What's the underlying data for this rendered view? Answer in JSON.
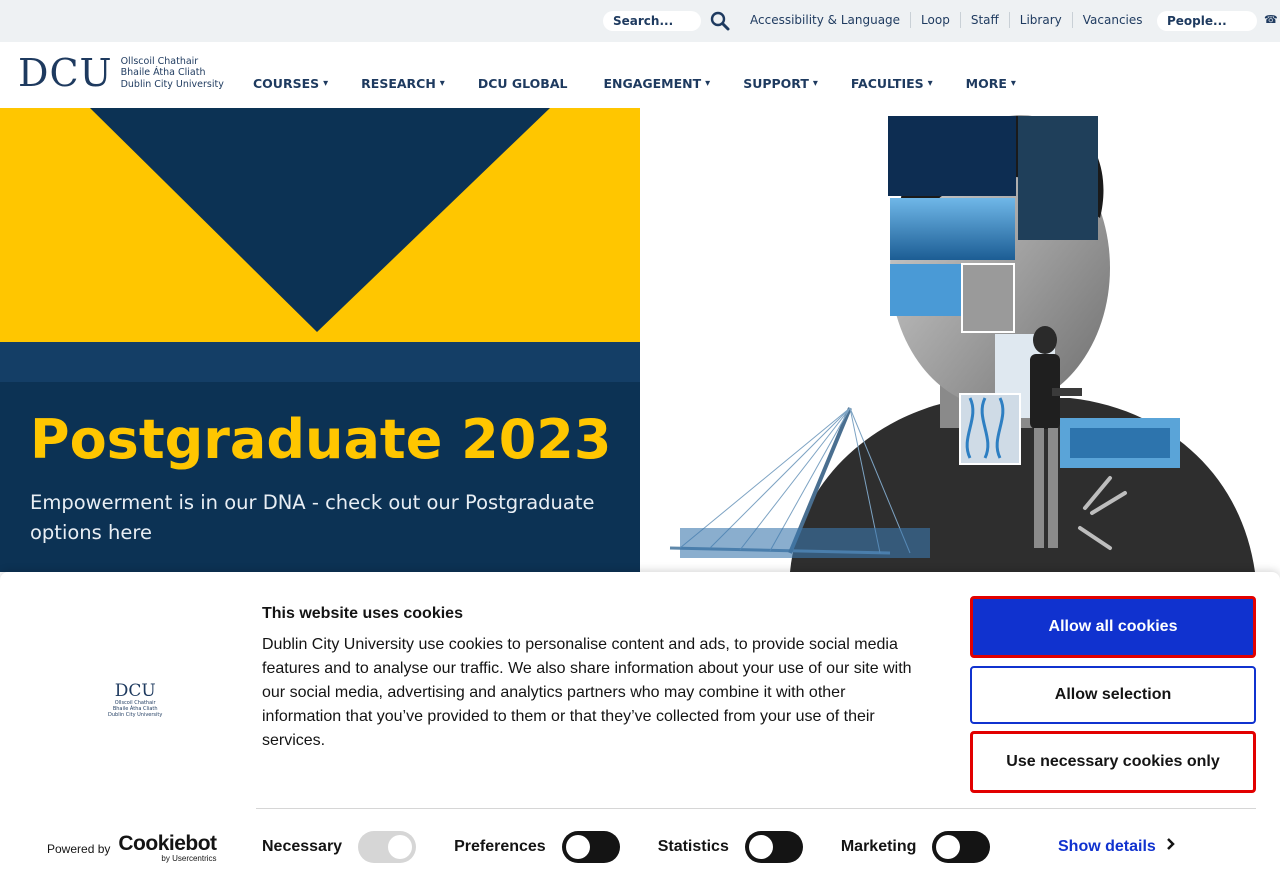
{
  "topbar": {
    "search_placeholder": "Search...",
    "links": [
      "Accessibility & Language",
      "Loop",
      "Staff",
      "Library",
      "Vacancies"
    ],
    "people_placeholder": "People...",
    "phone_glyph": "☎"
  },
  "header": {
    "logo_mark": "DCU",
    "logo_lines": [
      "Ollscoil Chathair",
      "Bhaile Átha Cliath",
      "Dublin City University"
    ],
    "nav": [
      {
        "label": "COURSES",
        "caret": true
      },
      {
        "label": "RESEARCH",
        "caret": true
      },
      {
        "label": "DCU GLOBAL",
        "caret": false
      },
      {
        "label": "ENGAGEMENT",
        "caret": true
      },
      {
        "label": "SUPPORT",
        "caret": true
      },
      {
        "label": "FACULTIES",
        "caret": true
      },
      {
        "label": "MORE",
        "caret": true
      }
    ],
    "caret_glyph": "▾"
  },
  "hero": {
    "title": "Postgraduate 2023",
    "subtitle": "Empowerment is in our DNA - check out our Postgraduate options here"
  },
  "cookie": {
    "title": "This website uses cookies",
    "description": "Dublin City University use cookies to personalise content and ads, to provide social media features and to analyse our traffic. We also share information about your use of our site with our social media, advertising and analytics partners who may combine it with other information that you’ve provided to them or that they’ve collected from your use of their services.",
    "allow_all": "Allow all cookies",
    "allow_selection": "Allow selection",
    "necessary_only": "Use necessary cookies only",
    "toggles": [
      "Necessary",
      "Preferences",
      "Statistics",
      "Marketing"
    ],
    "show_details": "Show details",
    "powered_by": "Powered by",
    "cookiebot": "Cookiebot",
    "by_usercentrics": "by Usercentrics",
    "logo_mark": "DCU",
    "logo_lines": [
      "Ollscoil Chathair",
      "Bhaile Átha Cliath",
      "Dublin City University"
    ]
  },
  "colors": {
    "navy": "#1e3a5f",
    "hero_navy": "#0c3254",
    "yellow": "#ffc600",
    "cookie_blue": "#1032cf",
    "cookie_red": "#e20000"
  }
}
